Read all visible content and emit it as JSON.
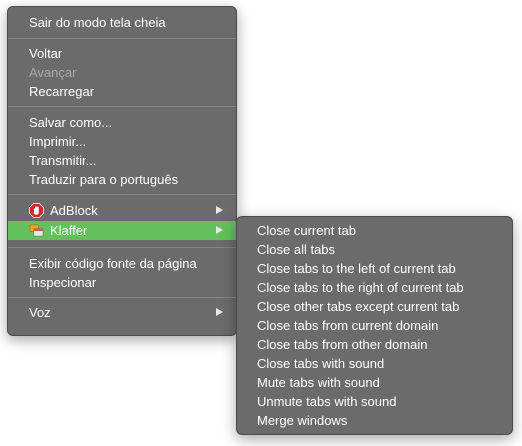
{
  "main_menu": {
    "exit_fullscreen": "Sair do modo tela cheia",
    "back": "Voltar",
    "forward": "Avançar",
    "reload": "Recarregar",
    "save_as": "Salvar como...",
    "print": "Imprimir...",
    "cast": "Transmitir...",
    "translate": "Traduzir para o português",
    "adblock": "AdBlock",
    "klaffer": "Klaffer",
    "view_source": "Exibir código fonte da página",
    "inspect": "Inspecionar",
    "voice": "Voz"
  },
  "submenu": {
    "items": [
      "Close current tab",
      "Close all tabs",
      "Close tabs to the left of current tab",
      "Close tabs to the right of current tab",
      "Close other tabs except current tab",
      "Close tabs from current domain",
      "Close tabs from other domain",
      "Close tabs with sound",
      "Mute tabs with sound",
      "Unmute tabs with sound",
      "Merge windows"
    ]
  },
  "icons": {
    "adblock": "adblock-hand-icon",
    "klaffer": "klaffer-tabs-icon",
    "submenu_arrow": "chevron-right-icon"
  },
  "colors": {
    "menu_background": "#6b6b6b",
    "highlight": "#63c05a",
    "disabled_text": "#a9a9a9",
    "adblock_red": "#d2272a"
  }
}
